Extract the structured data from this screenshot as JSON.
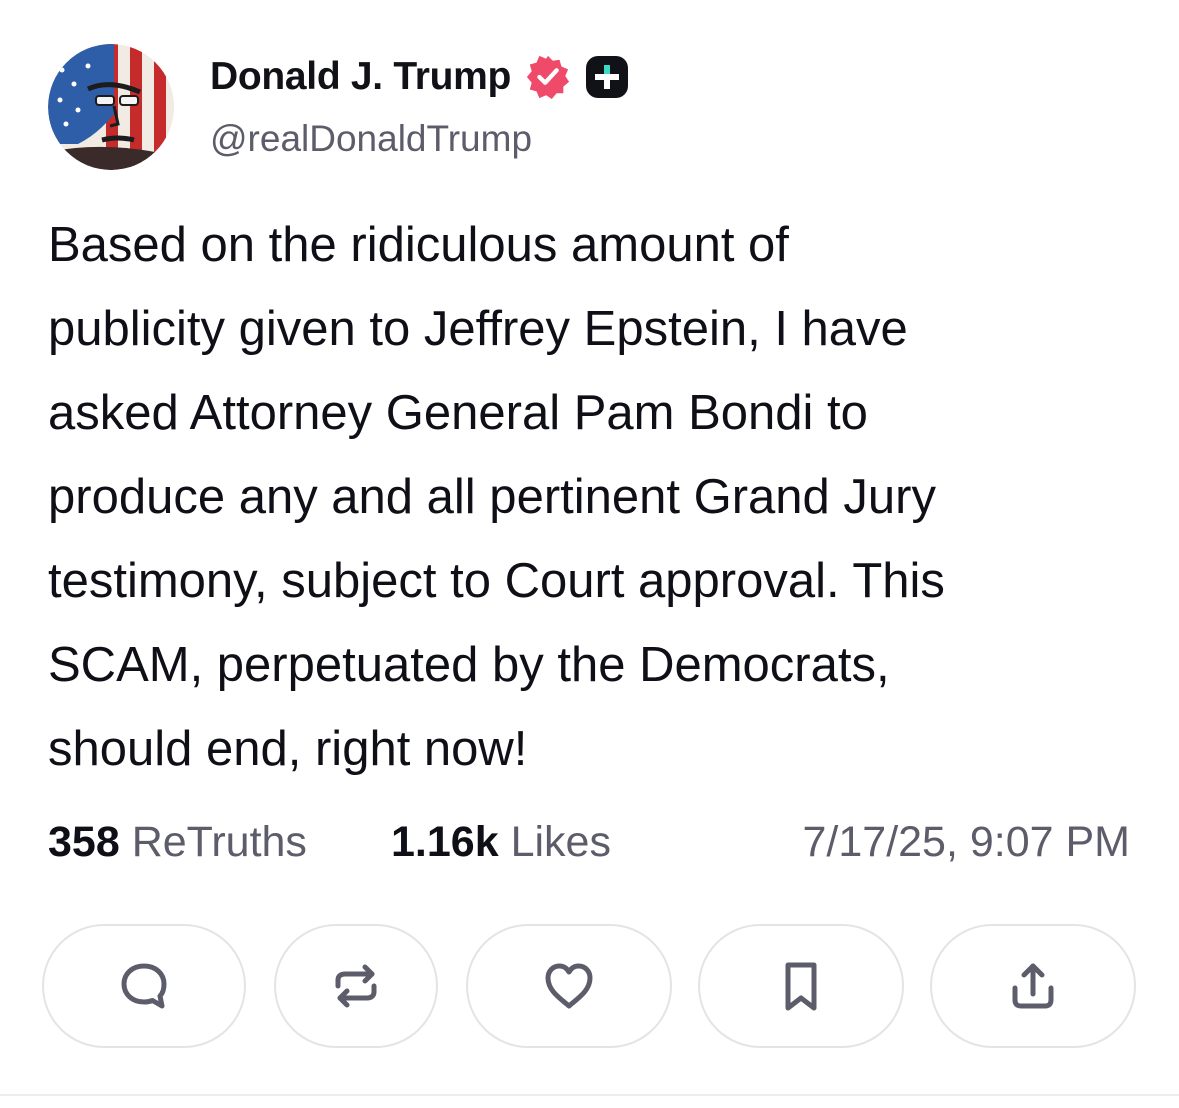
{
  "author": {
    "name": "Donald J. Trump",
    "handle": "@realDonaldTrump",
    "verified_color": "#ef4a6a",
    "avatar": "avatar"
  },
  "post": {
    "text": "Based on the ridiculous amount of\npublicity given to Jeffrey Epstein, I have\nasked Attorney General Pam Bondi to\nproduce any and all pertinent Grand Jury\ntestimony, subject to Court approval. This\nSCAM, perpetuated by the Democrats,\nshould end, right now!"
  },
  "stats": {
    "retruths_count": "358",
    "retruths_label": "ReTruths",
    "likes_count": "1.16k",
    "likes_label": "Likes",
    "timestamp": "7/17/25, 9:07 PM"
  },
  "actions": [
    {
      "name": "reply",
      "icon": "comment-icon"
    },
    {
      "name": "retruth",
      "icon": "repost-icon"
    },
    {
      "name": "like",
      "icon": "heart-icon"
    },
    {
      "name": "bookmark",
      "icon": "bookmark-icon"
    },
    {
      "name": "share",
      "icon": "share-icon"
    }
  ],
  "colors": {
    "text_primary": "#0f0f17",
    "text_secondary": "#5c5c6b",
    "border": "#e4e4e8",
    "icon": "#5c5c6b"
  }
}
